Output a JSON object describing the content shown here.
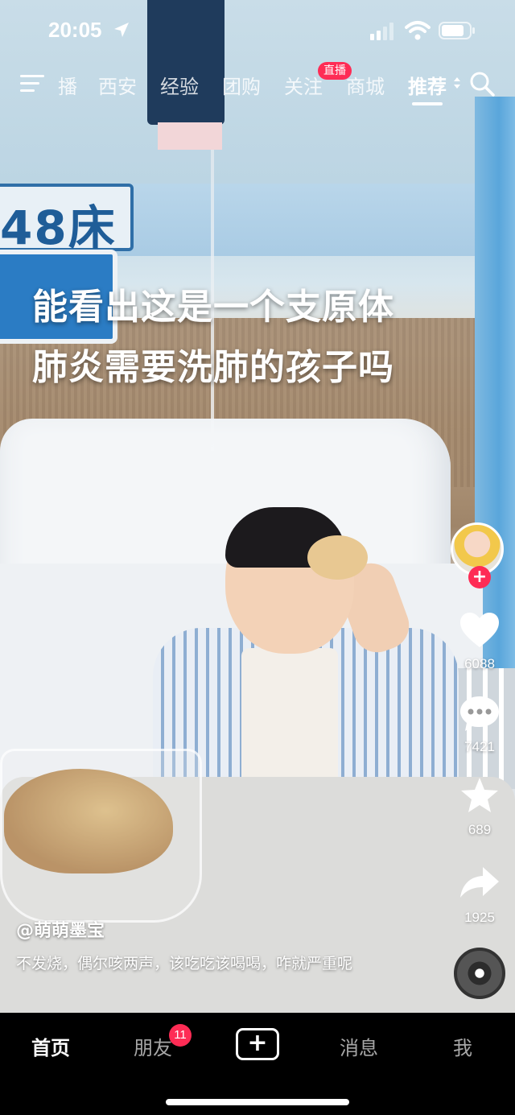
{
  "status_bar": {
    "time": "20:05"
  },
  "top_nav": {
    "tabs": [
      "播",
      "西安",
      "经验",
      "团购",
      "关注",
      "商城",
      "推荐"
    ],
    "active_tab": "推荐",
    "live_badge": "直播"
  },
  "scene": {
    "bed_number": "48床"
  },
  "overlay": {
    "line1": "能看出这是一个支原体",
    "line2": "肺炎需要洗肺的孩子吗"
  },
  "actions": {
    "likes": "6088",
    "comments": "7421",
    "favorites": "689",
    "shares": "1925"
  },
  "post": {
    "author": "@萌萌墨宝",
    "caption": "不发烧，偶尔咳两声，该吃吃该喝喝，咋就严重呢"
  },
  "bottom_nav": {
    "home": "首页",
    "friends": "朋友",
    "friends_badge": "11",
    "create": "+",
    "messages": "消息",
    "me": "我"
  },
  "colors": {
    "accent": "#fe2c55",
    "nav_bg": "#000000"
  }
}
